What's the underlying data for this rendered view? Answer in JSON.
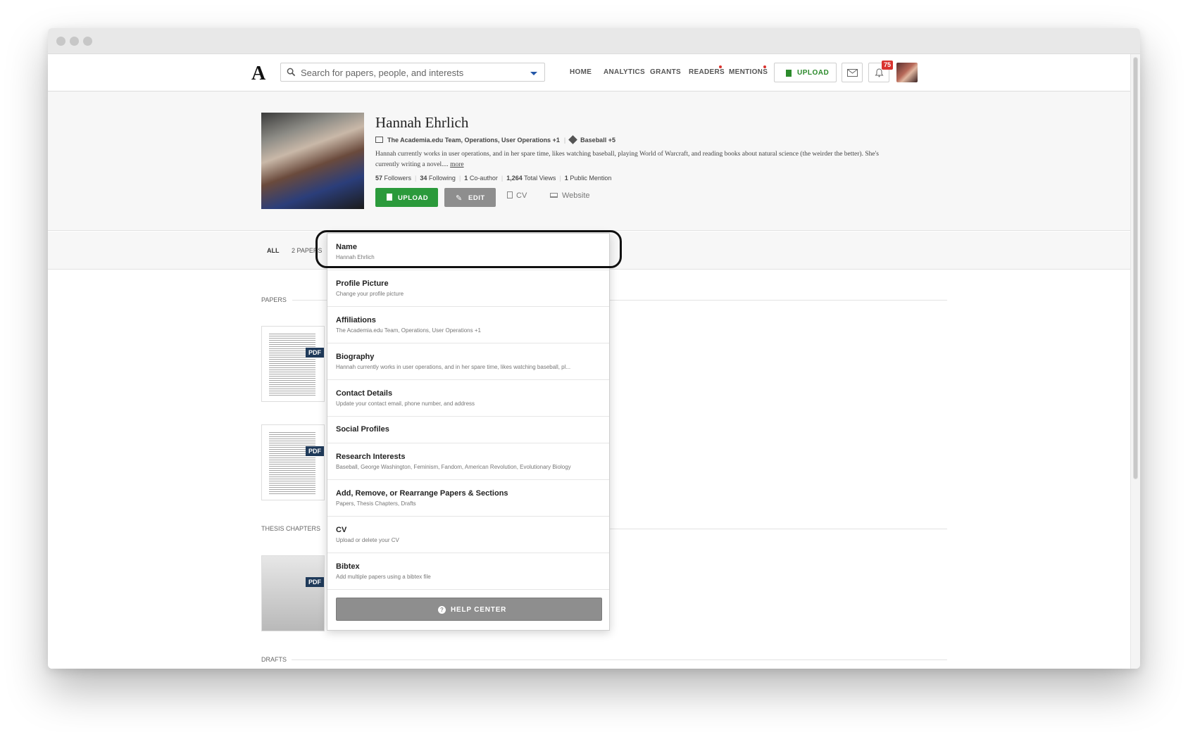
{
  "nav": {
    "logo": "A",
    "search_placeholder": "Search for papers, people, and interests",
    "links": [
      "HOME",
      "ANALYTICS",
      "GRANTS",
      "READERS",
      "MENTIONS"
    ],
    "upload_label": "UPLOAD",
    "notification_count": "75"
  },
  "profile": {
    "name": "Hannah Ehrlich",
    "affiliations": "The Academia.edu Team, Operations, User Operations +1",
    "interests": "Baseball +5",
    "bio": "Hannah currently works in user operations, and in her spare time, likes watching baseball, playing World of Warcraft, and reading books about natural science (the weirder the better). She's currently writing a novel....",
    "bio_more": "more",
    "stats": {
      "followers_n": "57",
      "followers_l": "Followers",
      "following_n": "34",
      "following_l": "Following",
      "coauthor_n": "1",
      "coauthor_l": "Co-author",
      "views_n": "1,264",
      "views_l": "Total Views",
      "mentions_n": "1",
      "mentions_l": "Public Mention"
    },
    "upload_button": "UPLOAD",
    "edit_button": "EDIT",
    "cv_link": "CV",
    "website_link": "Website"
  },
  "tabs": {
    "all": "ALL",
    "papers": "2  PAPERS"
  },
  "sections": {
    "papers": "PAPERS",
    "thesis": "THESIS CHAPTERS",
    "drafts": "DRAFTS",
    "pdf_badge": "PDF"
  },
  "menu": {
    "items": [
      {
        "title": "Name",
        "sub": "Hannah Ehrlich"
      },
      {
        "title": "Profile Picture",
        "sub": "Change your profile picture"
      },
      {
        "title": "Affiliations",
        "sub": "The Academia.edu Team, Operations, User Operations +1"
      },
      {
        "title": "Biography",
        "sub": "Hannah currently works in user operations, and in her spare time, likes watching baseball, pl..."
      },
      {
        "title": "Contact Details",
        "sub": "Update your contact email, phone number, and address"
      },
      {
        "title": "Social Profiles",
        "sub": ""
      },
      {
        "title": "Research Interests",
        "sub": "Baseball, George Washington, Feminism, Fandom, American Revolution, Evolutionary Biology"
      },
      {
        "title": "Add, Remove, or Rearrange Papers & Sections",
        "sub": "Papers, Thesis Chapters, Drafts"
      },
      {
        "title": "CV",
        "sub": "Upload or delete your CV"
      },
      {
        "title": "Bibtex",
        "sub": "Add multiple papers using a bibtex file"
      }
    ],
    "help_center": "HELP CENTER"
  },
  "colors": {
    "upload_green": "#2b9a3b",
    "edit_grey": "#8e8e8e",
    "alert_red": "#d9322e",
    "pdf_navy": "#1f3a5a"
  }
}
